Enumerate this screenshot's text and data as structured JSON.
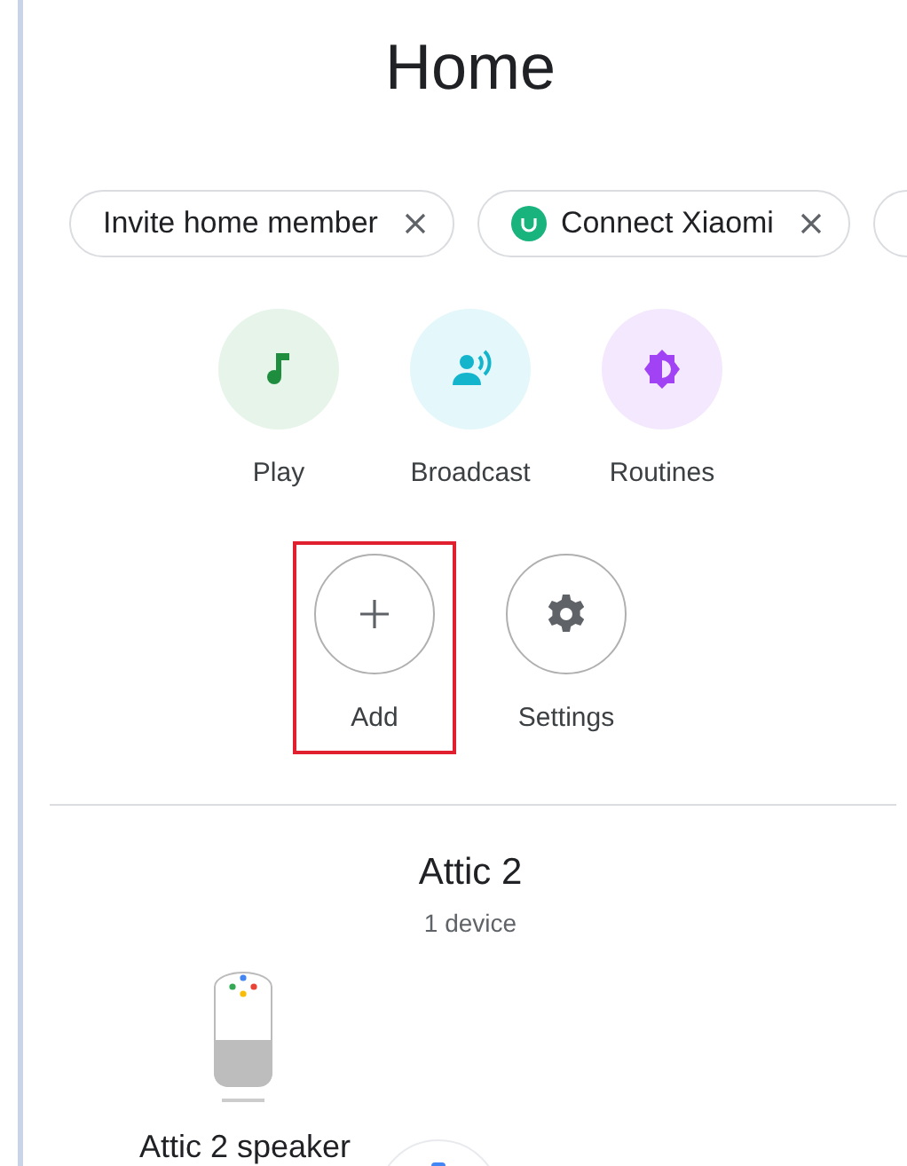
{
  "title": "Home",
  "chips": [
    {
      "label": "Invite home member",
      "kind": "plain"
    },
    {
      "label": "Connect Xiaomi",
      "kind": "logo"
    },
    {
      "kind": "partial"
    }
  ],
  "actions": [
    [
      {
        "label": "Play",
        "kind": "play",
        "highlighted": false
      },
      {
        "label": "Broadcast",
        "kind": "broadcast",
        "highlighted": false
      },
      {
        "label": "Routines",
        "kind": "routines",
        "highlighted": false
      }
    ],
    [
      {
        "label": "Add",
        "kind": "add",
        "highlighted": true
      },
      {
        "label": "Settings",
        "kind": "settings",
        "highlighted": false
      }
    ]
  ],
  "room": {
    "name": "Attic 2",
    "count": "1 device",
    "devices": [
      {
        "label": "Attic 2 speaker",
        "kind": "speaker"
      },
      {
        "kind": "partial"
      }
    ]
  }
}
